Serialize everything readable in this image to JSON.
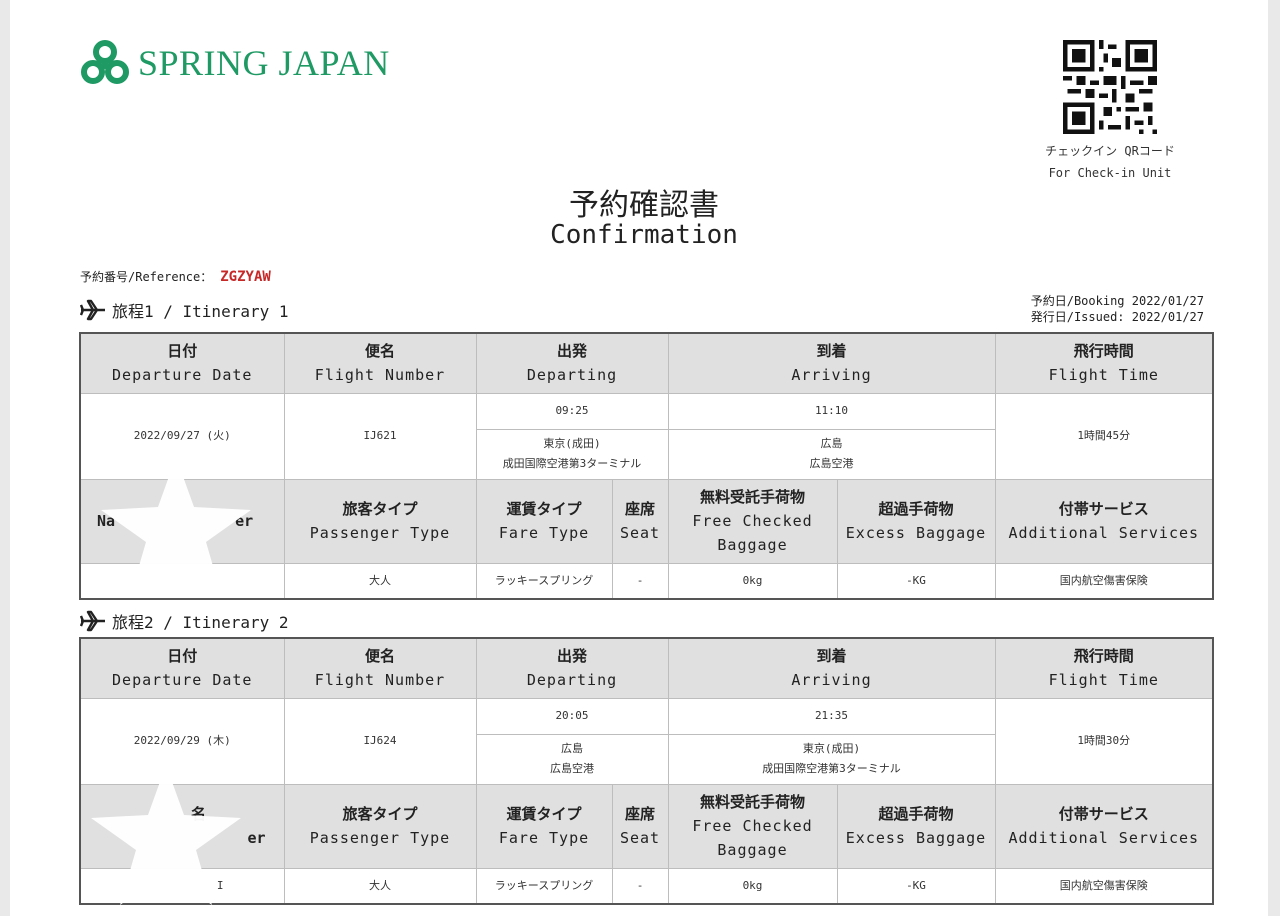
{
  "header": {
    "brand": "SPRING JAPAN",
    "qr_caption_jp": "チェックイン QRコード",
    "qr_caption_en": "For Check-in Unit",
    "title_jp": "予約確認書",
    "title_en": "Confirmation"
  },
  "reference": {
    "label": "予約番号/Reference：",
    "value": "ZGZYAW"
  },
  "dates": {
    "booking": "予約日/Booking 2022/01/27",
    "issued": "発行日/Issued: 2022/01/27"
  },
  "columns": {
    "date_jp": "日付",
    "date_en": "Departure Date",
    "flight_jp": "便名",
    "flight_en": "Flight Number",
    "dep_jp": "出発",
    "dep_en": "Departing",
    "arr_jp": "到着",
    "arr_en": "Arriving",
    "time_jp": "飛行時間",
    "time_en": "Flight Time",
    "pax_type_jp": "旅客タイプ",
    "pax_type_en": "Passenger Type",
    "fare_jp": "運賃タイプ",
    "fare_en": "Fare Type",
    "seat_jp": "座席",
    "seat_en": "Seat",
    "free_bag_jp": "無料受託手荷物",
    "free_bag_en_1": "Free Checked",
    "free_bag_en_2": "Baggage",
    "excess_jp": "超過手荷物",
    "excess_en": "Excess Baggage",
    "addl_jp": "付帯サービス",
    "addl_en": "Additional Services",
    "name_partial_1": "Na",
    "name_partial_2": "er",
    "name2_partial_1": "名",
    "name2_partial_2": "er"
  },
  "itineraries": [
    {
      "title": "旅程1 / Itinerary 1",
      "date": "2022/09/27 (火)",
      "flight": "IJ621",
      "dep_time": "09:25",
      "dep_place_1": "東京(成田)",
      "dep_place_2": "成田国際空港第3ターミナル",
      "arr_time": "11:10",
      "arr_place_1": "広島",
      "arr_place_2": "広島空港",
      "duration": "1時間45分",
      "passenger_name": "",
      "passenger_type": "大人",
      "fare_type": "ラッキースプリング",
      "seat": "-",
      "free_baggage": "0kg",
      "excess_baggage": "-KG",
      "additional": "国内航空傷害保険"
    },
    {
      "title": "旅程2 / Itinerary 2",
      "date": "2022/09/29 (木)",
      "flight": "IJ624",
      "dep_time": "20:05",
      "dep_place_1": "広島",
      "dep_place_2": "広島空港",
      "arr_time": "21:35",
      "arr_place_1": "東京(成田)",
      "arr_place_2": "成田国際空港第3ターミナル",
      "duration": "1時間30分",
      "passenger_name": "I",
      "passenger_type": "大人",
      "fare_type": "ラッキースプリング",
      "seat": "-",
      "free_baggage": "0kg",
      "excess_baggage": "-KG",
      "additional": "国内航空傷害保険"
    }
  ],
  "colors": {
    "brand_green": "#1f9a64",
    "reference_red": "#c62828",
    "header_gray": "#e0e0e0"
  },
  "icons": [
    "spring-japan-logo-icon",
    "qr-code-icon",
    "airplane-icon"
  ]
}
